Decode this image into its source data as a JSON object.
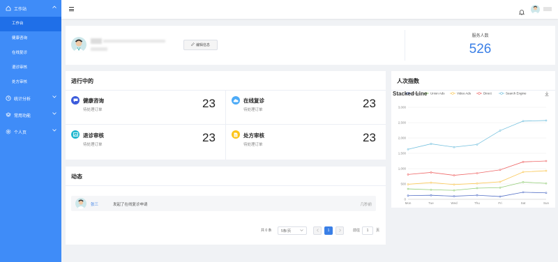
{
  "sidebar": {
    "group_workbench": "工作站",
    "items": [
      "工作台",
      "健康咨询",
      "在线复诊",
      "退诊审核",
      "处方审核"
    ],
    "group_stats": "统计分析",
    "group_common": "常用功能",
    "group_personal": "个人页"
  },
  "profile": {
    "edit_label": "编辑信息",
    "stat_label": "服务人数",
    "stat_value": "526"
  },
  "ongoing": {
    "title": "进行中的",
    "cards": [
      {
        "title": "健康咨询",
        "sub": "待处理订单",
        "count": "23",
        "color": "#3b5bdb",
        "icon": "chat-icon"
      },
      {
        "title": "在线复诊",
        "sub": "待处理订单",
        "count": "23",
        "color": "#4dabf7",
        "icon": "cloud-icon"
      },
      {
        "title": "退诊审核",
        "sub": "待处理订单",
        "count": "23",
        "color": "#22b8cf",
        "icon": "image-icon"
      },
      {
        "title": "处方审核",
        "sub": "待处理订单",
        "count": "23",
        "color": "#fcc419",
        "icon": "document-icon"
      }
    ]
  },
  "activity": {
    "title": "动态",
    "name": "张三",
    "action": "发起了在线复诊申请",
    "time": "几秒前"
  },
  "pagination": {
    "total": "共 0 条",
    "page_size": "5条/页",
    "current_page": "1",
    "goto_label": "前往",
    "goto_value": "1",
    "page_unit": "页"
  },
  "chart_panel_title": "人次指数",
  "chart_data": {
    "type": "line",
    "title": "Stacked Line",
    "categories": [
      "Mon",
      "Tue",
      "Wed",
      "Thu",
      "Fri",
      "Sat",
      "Sun"
    ],
    "ylim": [
      0,
      3000
    ],
    "yticks": [
      "0",
      "500",
      "1,000",
      "1,500",
      "2,000",
      "2,500",
      "3,000"
    ],
    "grid": true,
    "legend_position": "top",
    "series": [
      {
        "name": "Email",
        "color": "#5470c6",
        "values": [
          120,
          132,
          101,
          134,
          90,
          230,
          210
        ]
      },
      {
        "name": "Union Ads",
        "color": "#91cc75",
        "values": [
          340,
          312,
          292,
          364,
          380,
          560,
          520
        ]
      },
      {
        "name": "Video Ads",
        "color": "#fac858",
        "values": [
          490,
          544,
          482,
          518,
          570,
          890,
          930
        ]
      },
      {
        "name": "Direct",
        "color": "#ee6666",
        "values": [
          810,
          876,
          783,
          852,
          960,
          1220,
          1250
        ]
      },
      {
        "name": "Search Engine",
        "color": "#73c0de",
        "values": [
          1630,
          1808,
          1701,
          1786,
          2240,
          2550,
          2570
        ]
      }
    ]
  }
}
